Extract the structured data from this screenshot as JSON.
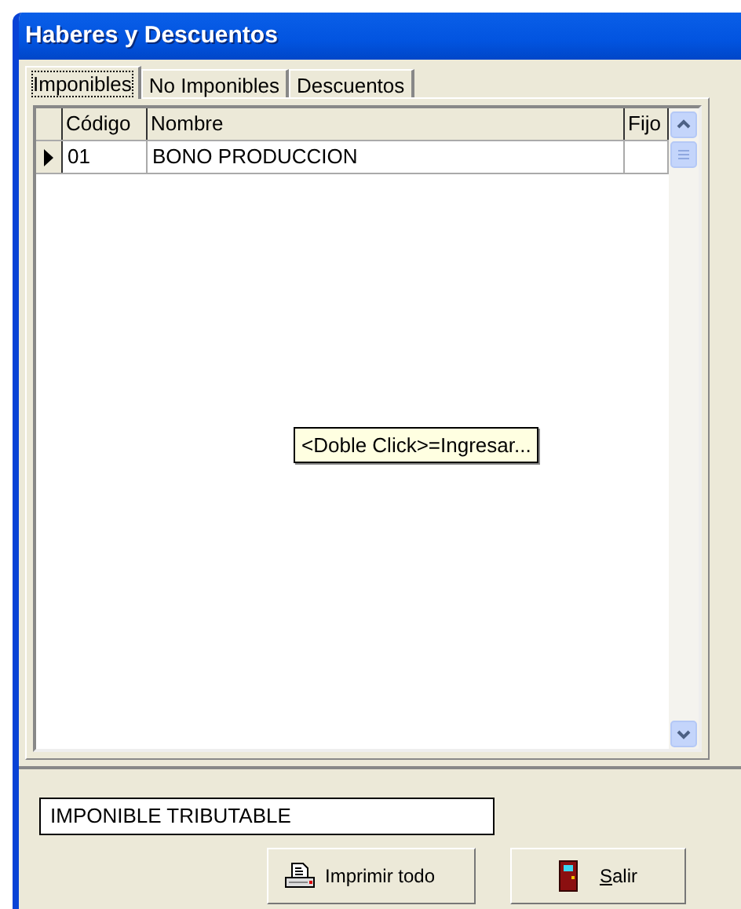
{
  "window": {
    "title": "Haberes y Descuentos"
  },
  "tabs": [
    {
      "label": "Imponibles",
      "selected": true
    },
    {
      "label": "No Imponibles",
      "selected": false
    },
    {
      "label": "Descuentos",
      "selected": false
    }
  ],
  "table": {
    "columns": [
      "Código",
      "Nombre",
      "Fijo"
    ],
    "rows": [
      {
        "cells": [
          "01",
          "BONO PRODUCCION",
          ""
        ],
        "current": true
      }
    ]
  },
  "tooltip": "<Doble Click>=Ingresar...",
  "description": {
    "value": "IMPONIBLE TRIBUTABLE"
  },
  "buttons": [
    {
      "label": "Imprimir todo",
      "kind": "printer",
      "mnemonic_first": false
    },
    {
      "label": "Salir",
      "kind": "door",
      "mnemonic_first": true
    }
  ]
}
